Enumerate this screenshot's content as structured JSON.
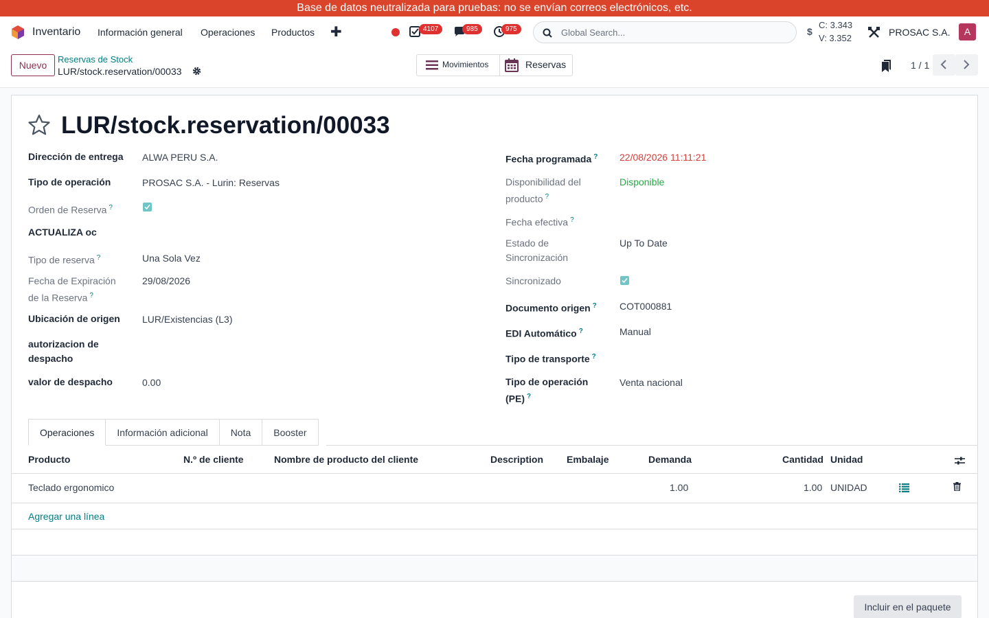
{
  "banner": {
    "text": "Base de datos neutralizada para pruebas: no se envían correos electrónicos, etc."
  },
  "navbar": {
    "app_name": "Inventario",
    "menu": [
      "Información general",
      "Operaciones",
      "Productos"
    ],
    "badges": {
      "activities": "4107",
      "messages": "985",
      "timesheet": "975"
    },
    "search_placeholder": "Global Search...",
    "rates": {
      "buy": "C: 3.343",
      "sell": "V: 3.352"
    },
    "currency_symbol": "$",
    "company": "PROSAC S.A.",
    "avatar_letter": "A",
    "avatar_color": "#b5375e"
  },
  "control": {
    "new_label": "Nuevo",
    "breadcrumb_parent": "Reservas de Stock",
    "breadcrumb_current": "LUR/stock.reservation/00033",
    "smart_buttons": [
      "Movimientos",
      "Reservas"
    ],
    "pager": "1 / 1"
  },
  "record": {
    "title": "LUR/stock.reservation/00033",
    "left_fields": [
      {
        "label": "Dirección de entrega",
        "value": "ALWA PERU S.A."
      },
      {
        "label": "Tipo de operación",
        "value": "PROSAC S.A. - Lurin: Reservas"
      },
      {
        "label": "Orden de Reserva",
        "value": ""
      },
      {
        "label": "ACTUALIZA oc",
        "value": ""
      },
      {
        "label": "Tipo de reserva",
        "value": "Una Sola Vez"
      },
      {
        "label_line1": "Fecha de Expiración",
        "label_line2": "de la Reserva",
        "value": "29/08/2026"
      },
      {
        "label": "Ubicación de origen",
        "value": "LUR/Existencias (L3)"
      },
      {
        "label_line1": "autorizacion de",
        "label_line2": "despacho",
        "value": ""
      },
      {
        "label": "valor de despacho",
        "value": "0.00"
      }
    ],
    "right_fields": [
      {
        "label": "Fecha programada",
        "value": "22/08/2026 11:11:21"
      },
      {
        "label_line1": "Disponibilidad del",
        "label_line2": "producto",
        "value": "Disponible"
      },
      {
        "label": "Fecha efectiva",
        "value": ""
      },
      {
        "label_line1": "Estado de",
        "label_line2": "Sincronización",
        "value": "Up To Date"
      },
      {
        "label": "Sincronizado",
        "value": ""
      },
      {
        "label": "Documento origen",
        "value": "COT000881"
      },
      {
        "label": "EDI Automático",
        "value": "Manual"
      },
      {
        "label": "Tipo de transporte",
        "value": ""
      },
      {
        "label_line1": "Tipo de operación",
        "label_line2": "(PE)",
        "value": "Venta nacional"
      }
    ],
    "help_mark": "?",
    "colors": {
      "date_overdue": "#d23f3a",
      "available": "#28a745",
      "link": "#017e84",
      "primary": "#8d2f52"
    }
  },
  "tabs": [
    "Operaciones",
    "Información adicional",
    "Nota",
    "Booster"
  ],
  "table": {
    "headers": [
      "Producto",
      "N.º de cliente",
      "Nombre de producto del cliente",
      "Description",
      "Embalaje",
      "Demanda",
      "Cantidad",
      "Unidad"
    ],
    "rows": [
      {
        "product": "Teclado ergonomico",
        "demand": "1.00",
        "quantity": "1.00",
        "unit": "UNIDAD"
      }
    ],
    "add_line": "Agregar una línea"
  },
  "footer": {
    "pack_button": "Incluir en el paquete"
  }
}
